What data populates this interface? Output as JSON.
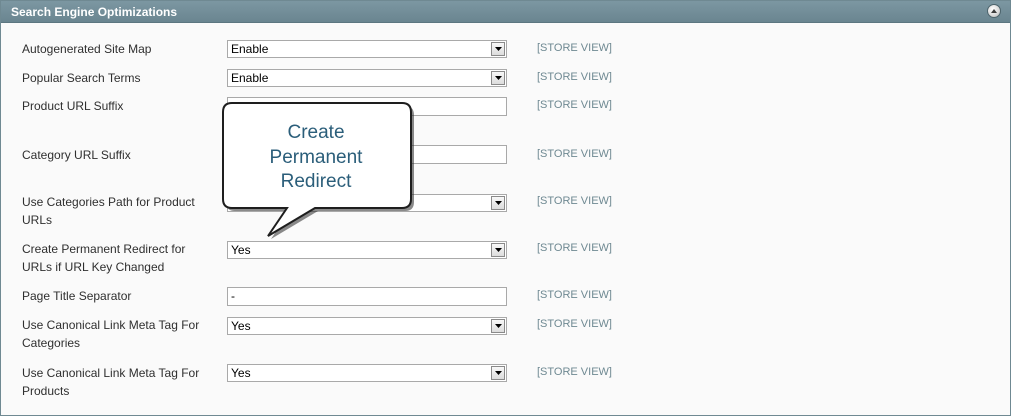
{
  "panel": {
    "title": "Search Engine Optimizations",
    "collapse_icon": "collapse-up-icon"
  },
  "rows": [
    {
      "label": "Autogenerated Site Map",
      "type": "select",
      "value": "Enable",
      "scope": "[STORE VIEW]"
    },
    {
      "label": "Popular Search Terms",
      "type": "select",
      "value": "Enable",
      "scope": "[STORE VIEW]"
    },
    {
      "label": "Product URL Suffix",
      "type": "text",
      "value": "",
      "scope": "[STORE VIEW]"
    },
    {
      "label": "Category URL Suffix",
      "type": "text",
      "value": "",
      "scope": "[STORE VIEW]"
    },
    {
      "label": "Use Categories Path for Product URLs",
      "type": "select",
      "value": "",
      "scope": "[STORE VIEW]"
    },
    {
      "label": "Create Permanent Redirect for URLs if URL Key Changed",
      "type": "select",
      "value": "Yes",
      "scope": "[STORE VIEW]"
    },
    {
      "label": "Page Title Separator",
      "type": "text",
      "value": "-",
      "scope": "[STORE VIEW]"
    },
    {
      "label": "Use Canonical Link Meta Tag For Categories",
      "type": "select",
      "value": "Yes",
      "scope": "[STORE VIEW]"
    },
    {
      "label": "Use Canonical Link Meta Tag For Products",
      "type": "select",
      "value": "Yes",
      "scope": "[STORE VIEW]"
    }
  ],
  "callout": {
    "line1": "Create",
    "line2": "Permanent",
    "line3": "Redirect"
  },
  "colors": {
    "header_bg": "#6f8992",
    "scope_text": "#6f8992",
    "callout_text": "#2b5e7a"
  }
}
